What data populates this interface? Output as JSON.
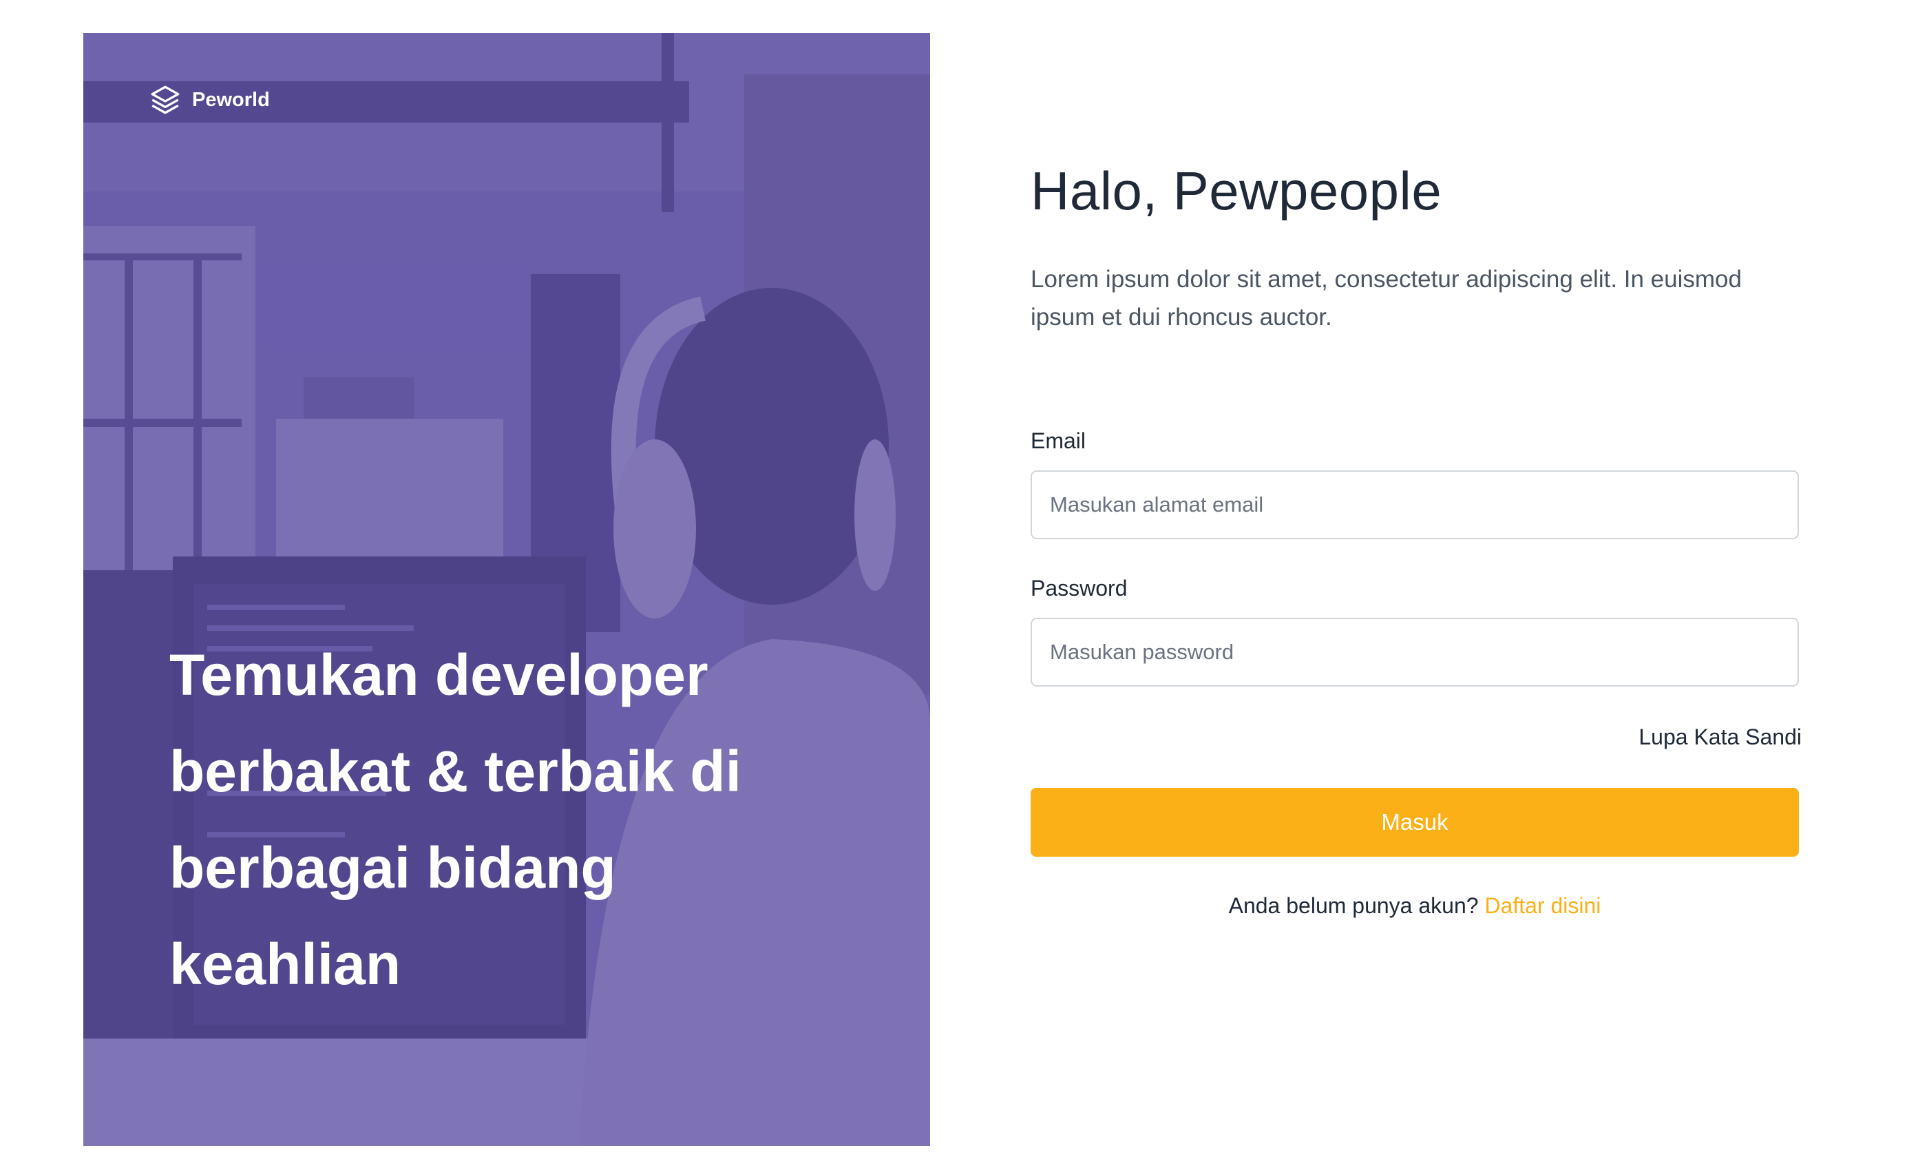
{
  "brand": {
    "name": "Peworld",
    "icon": "layers-icon"
  },
  "hero": {
    "headline": "Temukan developer berbakat & terbaik di berbagai bidang keahlian",
    "overlay_color": "#5e50a1"
  },
  "form": {
    "title": "Halo, Pewpeople",
    "description": "Lorem ipsum dolor sit amet, consectetur adipiscing elit. In euismod ipsum et dui rhoncus auctor.",
    "email": {
      "label": "Email",
      "placeholder": "Masukan alamat email",
      "value": ""
    },
    "password": {
      "label": "Password",
      "placeholder": "Masukan password",
      "value": ""
    },
    "forgot_label": "Lupa Kata Sandi",
    "submit_label": "Masuk",
    "signup_prompt": "Anda belum punya akun?",
    "signup_link": "Daftar disini"
  },
  "colors": {
    "accent": "#fbb017",
    "primary_purple": "#5e50a1",
    "text": "#1f2937",
    "muted": "#4b5563",
    "input_border": "#d1d5db"
  }
}
